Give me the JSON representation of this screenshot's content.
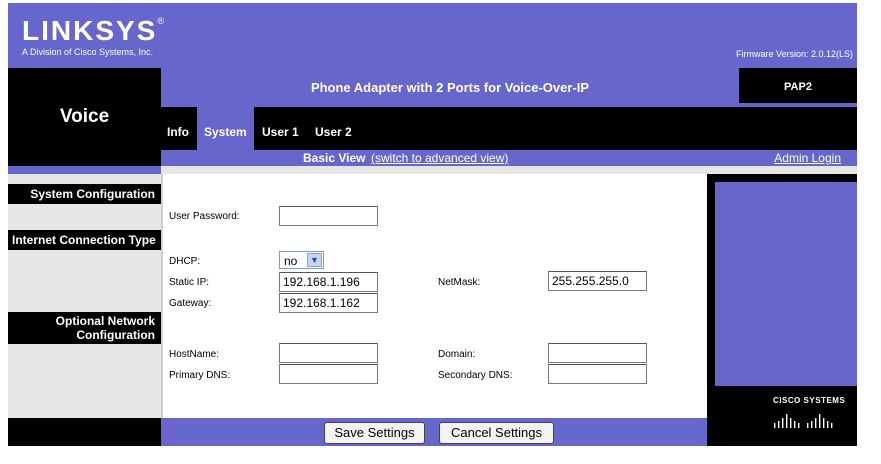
{
  "header": {
    "logo": "LINKSYS",
    "logo_mark": "®",
    "tagline": "A Division of Cisco Systems, Inc.",
    "firmware": "Firmware Version: 2.0.12(LS)"
  },
  "section_title": "Voice",
  "title_bar": "Phone Adapter with 2 Ports for Voice-Over-IP",
  "model": "PAP2",
  "tabs": [
    {
      "label": "Info",
      "active": false
    },
    {
      "label": "System",
      "active": true
    },
    {
      "label": "User 1",
      "active": false
    },
    {
      "label": "User 2",
      "active": false
    }
  ],
  "view_bar": {
    "basic_view": "Basic View",
    "switch_link": "(switch to advanced view)",
    "admin_login": "Admin Login"
  },
  "sidebar": {
    "system_configuration": "System Configuration",
    "internet_connection_type": "Internet Connection Type",
    "optional_network_line1": "Optional Network",
    "optional_network_line2": "Configuration"
  },
  "form": {
    "user_password_label": "User Password:",
    "user_password_value": "",
    "dhcp_label": "DHCP:",
    "dhcp_value": "no",
    "static_ip_label": "Static IP:",
    "static_ip_value": "192.168.1.196",
    "netmask_label": "NetMask:",
    "netmask_value": "255.255.255.0",
    "gateway_label": "Gateway:",
    "gateway_value": "192.168.1.162",
    "hostname_label": "HostName:",
    "hostname_value": "",
    "domain_label": "Domain:",
    "domain_value": "",
    "primary_dns_label": "Primary DNS:",
    "primary_dns_value": "",
    "secondary_dns_label": "Secondary DNS:",
    "secondary_dns_value": ""
  },
  "buttons": {
    "save": "Save Settings",
    "cancel": "Cancel Settings"
  },
  "cisco_logo": "CISCO SYSTEMS",
  "colors": {
    "brand_purple": "#6666cc",
    "black": "#000000",
    "sidebar_gray": "#e6e6e6"
  }
}
